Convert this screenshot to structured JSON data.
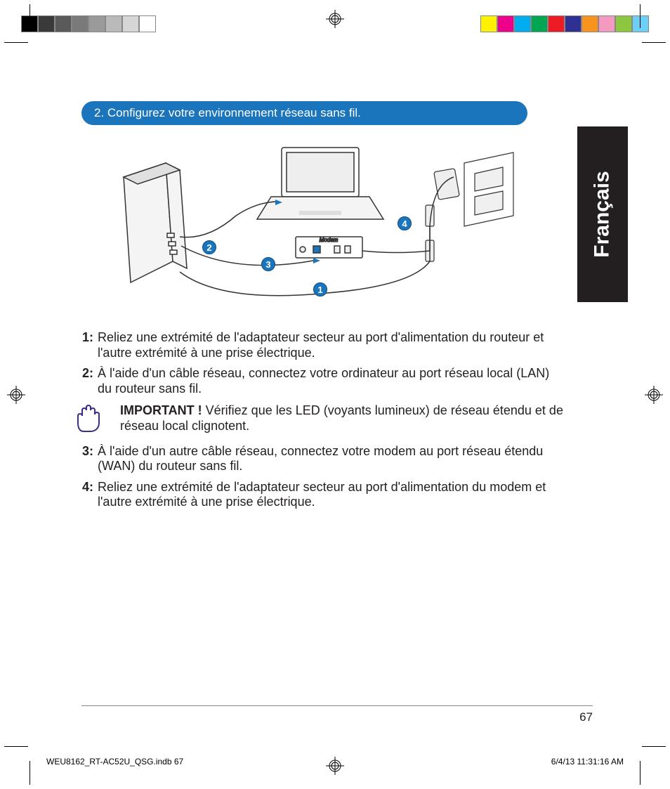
{
  "colorbar": {
    "left": [
      "#000000",
      "#3a3a3a",
      "#5a5a5a",
      "#7a7a7a",
      "#9a9a9a",
      "#bababa",
      "#d6d6d6",
      "#ffffff"
    ],
    "right": [
      "#fff200",
      "#ec008c",
      "#00aeef",
      "#00a651",
      "#ed1c24",
      "#2e3192",
      "#f7941d",
      "#f49ac1",
      "#8dc63f",
      "#6dcff6"
    ]
  },
  "language_tab": "Français",
  "section_heading": "2.  Configurez votre environnement réseau sans fil.",
  "diagram": {
    "modem_label": "Modem",
    "callouts": [
      "1",
      "2",
      "3",
      "4"
    ]
  },
  "steps": [
    {
      "num": "1:",
      "text": "Reliez une extrémité de l'adaptateur secteur au port d'alimentation du routeur et l'autre extrémité à une prise électrique."
    },
    {
      "num": "2:",
      "text": "À l'aide d'un câble réseau, connectez votre ordinateur au port réseau local (LAN) du routeur sans fil."
    }
  ],
  "important": {
    "lead": "IMPORTANT !",
    "text": "  Vérifiez que les LED (voyants lumineux) de réseau étendu et de réseau local clignotent."
  },
  "steps2": [
    {
      "num": "3:",
      "text": "À l'aide d'un autre câble réseau, connectez votre modem au port réseau étendu (WAN) du routeur sans fil."
    },
    {
      "num": "4:",
      "text": "Reliez une extrémité de l'adaptateur secteur au port d'alimentation du modem et l'autre extrémité à une prise électrique."
    }
  ],
  "page_number": "67",
  "slug": {
    "file": "WEU8162_RT-AC52U_QSG.indb   67",
    "date": "6/4/13   11:31:16 AM"
  }
}
